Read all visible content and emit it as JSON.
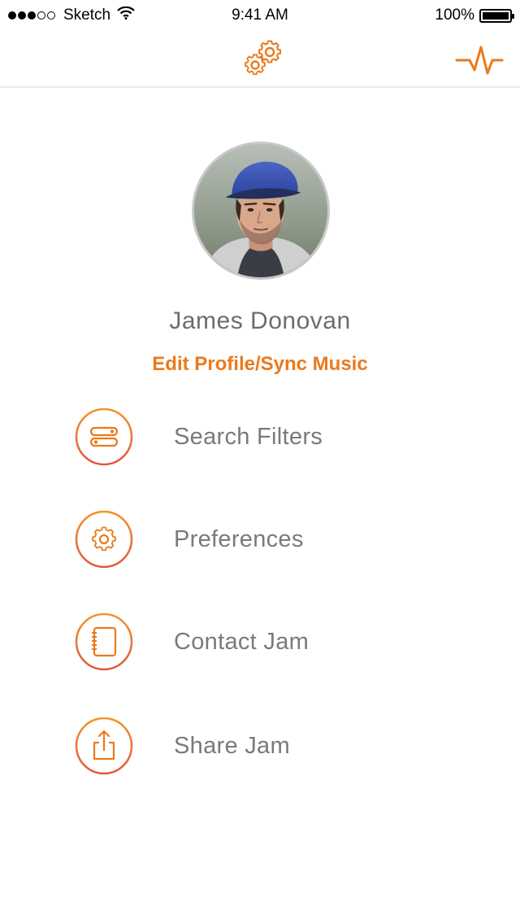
{
  "status_bar": {
    "carrier": "Sketch",
    "time": "9:41 AM",
    "battery": "100%",
    "battery_level": 1.0
  },
  "nav": {
    "left_icon": "gears-icon",
    "right_icon": "pulse-icon"
  },
  "profile": {
    "name": "James Donovan",
    "edit_link": "Edit Profile/Sync Music"
  },
  "menu": {
    "items": [
      {
        "label": "Search Filters",
        "icon": "filters-icon"
      },
      {
        "label": "Preferences",
        "icon": "gear-icon"
      },
      {
        "label": "Contact Jam",
        "icon": "notebook-icon"
      },
      {
        "label": "Share Jam",
        "icon": "share-icon"
      }
    ]
  },
  "colors": {
    "accent": "#ea7a1c",
    "accent_ring_top": "#f2962a",
    "accent_ring_bottom": "#e2553a",
    "text": "#7a7a7a"
  }
}
